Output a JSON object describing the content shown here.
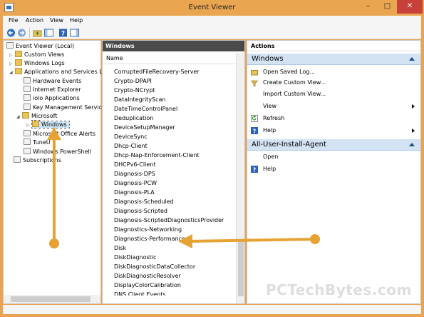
{
  "window": {
    "title": "Event Viewer",
    "min": "–",
    "max": "□",
    "close": "✕"
  },
  "menu": [
    "File",
    "Action",
    "View",
    "Help"
  ],
  "tree": {
    "root": "Event Viewer (Local)",
    "items": [
      {
        "label": "Custom Views"
      },
      {
        "label": "Windows Logs"
      },
      {
        "label": "Applications and Services Lo"
      },
      {
        "label": "Hardware Events"
      },
      {
        "label": "Internet Explorer"
      },
      {
        "label": "iolo Applications"
      },
      {
        "label": "Key Management Service"
      },
      {
        "label": "Microsoft"
      },
      {
        "label": "Windows"
      },
      {
        "label": "Microsoft Office Alerts"
      },
      {
        "label": "TuneU"
      },
      {
        "label": "Windows PowerShell"
      },
      {
        "label": "Subscriptions"
      }
    ]
  },
  "middle": {
    "header": "Windows",
    "column": "Name",
    "rows": [
      "CorruptedFileRecovery-Server",
      "Crypto-DPAPI",
      "Crypto-NCrypt",
      "DataIntegrityScan",
      "DateTimeControlPanel",
      "Deduplication",
      "DeviceSetupManager",
      "DeviceSync",
      "Dhcp-Client",
      "Dhcp-Nap-Enforcement-Client",
      "DHCPv6-Client",
      "Diagnosis-DPS",
      "Diagnosis-PCW",
      "Diagnosis-PLA",
      "Diagnosis-Scheduled",
      "Diagnosis-Scripted",
      "Diagnosis-ScriptedDiagnosticsProvider",
      "Diagnostics-Networking",
      "Diagnostics-Performance",
      "Disk",
      "DiskDiagnostic",
      "DiskDiagnosticDataCollector",
      "DiskDiagnosticResolver",
      "DisplayColorCalibration",
      "DNS Client Events"
    ]
  },
  "actions": {
    "header": "Actions",
    "section1": "Windows",
    "items1": [
      {
        "label": "Open Saved Log...",
        "icon": "folder-open-icon"
      },
      {
        "label": "Create Custom View...",
        "icon": "filter-icon"
      },
      {
        "label": "Import Custom View...",
        "icon": ""
      },
      {
        "label": "View",
        "icon": "",
        "submenu": true
      },
      {
        "label": "Refresh",
        "icon": "refresh-icon"
      },
      {
        "label": "Help",
        "icon": "help-icon",
        "submenu": true
      }
    ],
    "section2": "All-User-Install-Agent",
    "items2": [
      {
        "label": "Open",
        "icon": ""
      },
      {
        "label": "Help",
        "icon": "help-icon",
        "submenu": false
      }
    ]
  },
  "watermark": "PCTechBytes.com",
  "colors": {
    "accent": "#e9a353",
    "arrow": "#e6a233",
    "section_bg": "#d3e3f3"
  }
}
